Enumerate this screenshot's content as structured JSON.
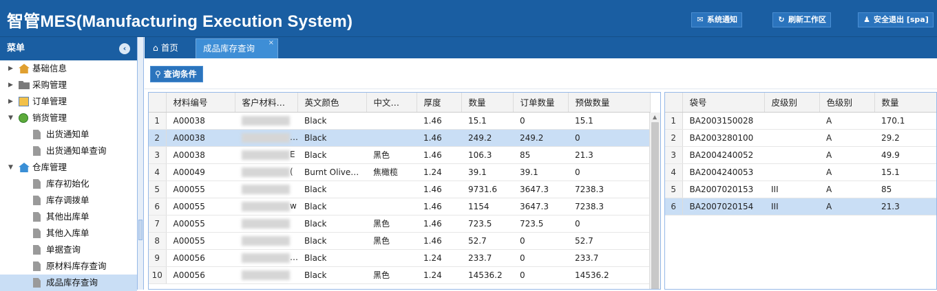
{
  "header": {
    "title": "智管MES(Manufacturing Execution System)",
    "buttons": [
      {
        "label": "系统通知",
        "icon": "mail-icon"
      },
      {
        "label": "刷新工作区",
        "icon": "refresh-icon"
      },
      {
        "label": "安全退出 [spa]",
        "icon": "user-icon"
      }
    ]
  },
  "sidebar": {
    "title": "菜单",
    "tree": [
      {
        "label": "基础信息",
        "icon": "house-icon",
        "level": 0,
        "expanded": false
      },
      {
        "label": "采购管理",
        "icon": "folder-icon",
        "level": 0,
        "expanded": false
      },
      {
        "label": "订单管理",
        "icon": "document-icon",
        "level": 0,
        "expanded": false
      },
      {
        "label": "销货管理",
        "icon": "globe-icon",
        "level": 0,
        "expanded": true
      },
      {
        "label": "出货通知单",
        "icon": "file-icon",
        "level": 1
      },
      {
        "label": "出货通知单查询",
        "icon": "file-icon",
        "level": 1
      },
      {
        "label": "仓库管理",
        "icon": "warehouse-icon",
        "level": 0,
        "expanded": true
      },
      {
        "label": "库存初始化",
        "icon": "file-icon",
        "level": 1
      },
      {
        "label": "库存调拨单",
        "icon": "file-icon",
        "level": 1
      },
      {
        "label": "其他出库单",
        "icon": "file-icon",
        "level": 1
      },
      {
        "label": "其他入库单",
        "icon": "file-icon",
        "level": 1
      },
      {
        "label": "单据查询",
        "icon": "file-icon",
        "level": 1
      },
      {
        "label": "原材料库存查询",
        "icon": "file-icon",
        "level": 1
      },
      {
        "label": "成品库存查询",
        "icon": "file-icon",
        "level": 1,
        "selected": true
      }
    ]
  },
  "tabs": {
    "home": "首页",
    "active": "成品库存查询",
    "close": "×"
  },
  "toolbar": {
    "query_button": "查询条件"
  },
  "left_grid": {
    "columns": [
      "",
      "材料编号",
      "客户材料…",
      "英文颜色",
      "中文…",
      "厚度",
      "数量",
      "订单数量",
      "预做数量"
    ],
    "rows": [
      [
        "1",
        "A00038",
        "",
        "Black",
        "",
        "1.46",
        "15.1",
        "0",
        "15.1"
      ],
      [
        "2",
        "A00038",
        "…",
        "Black",
        "",
        "1.46",
        "249.2",
        "249.2",
        "0"
      ],
      [
        "3",
        "A00038",
        "E",
        "Black",
        "黑色",
        "1.46",
        "106.3",
        "85",
        "21.3"
      ],
      [
        "4",
        "A00049",
        "(",
        "Burnt Olive…",
        "焦橄榄",
        "1.24",
        "39.1",
        "39.1",
        "0"
      ],
      [
        "5",
        "A00055",
        "",
        "Black",
        "",
        "1.46",
        "9731.6",
        "3647.3",
        "7238.3"
      ],
      [
        "6",
        "A00055",
        "w",
        "Black",
        "",
        "1.46",
        "1154",
        "3647.3",
        "7238.3"
      ],
      [
        "7",
        "A00055",
        "",
        "Black",
        "黑色",
        "1.46",
        "723.5",
        "723.5",
        "0"
      ],
      [
        "8",
        "A00055",
        "",
        "Black",
        "黑色",
        "1.46",
        "52.7",
        "0",
        "52.7"
      ],
      [
        "9",
        "A00056",
        "de",
        "Black",
        "",
        "1.24",
        "233.7",
        "0",
        "233.7"
      ],
      [
        "10",
        "A00056",
        "",
        "Black",
        "黑色",
        "1.24",
        "14536.2",
        "0",
        "14536.2"
      ]
    ]
  },
  "right_grid": {
    "columns": [
      "",
      "袋号",
      "皮级别",
      "色级别",
      "数量"
    ],
    "rows": [
      [
        "1",
        "BA2003150028",
        "",
        "A",
        "170.1"
      ],
      [
        "2",
        "BA2003280100",
        "",
        "A",
        "29.2"
      ],
      [
        "3",
        "BA2004240052",
        "",
        "A",
        "49.9"
      ],
      [
        "4",
        "BA2004240053",
        "",
        "A",
        "15.1"
      ],
      [
        "5",
        "BA2007020153",
        "III",
        "A",
        "85"
      ],
      [
        "6",
        "BA2007020154",
        "III",
        "A",
        "21.3"
      ]
    ]
  }
}
